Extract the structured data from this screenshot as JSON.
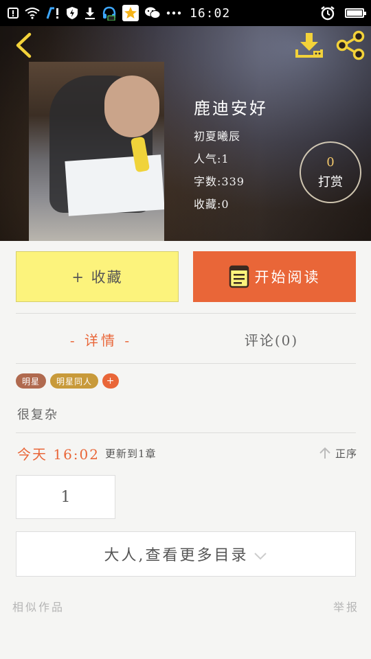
{
  "status_bar": {
    "time": "16:02",
    "icons": [
      "notification-icon",
      "wifi-icon",
      "app-icon",
      "shield-icon",
      "download-icon",
      "headset-icon",
      "star-icon",
      "wechat-icon",
      "more-icon",
      "alarm-icon",
      "battery-icon"
    ]
  },
  "book": {
    "title": "鹿迪安好",
    "author": "初夏曦辰",
    "popularity": "人气:1",
    "word_count": "字数:339",
    "favorites": "收藏:0"
  },
  "reward": {
    "count": "0",
    "label": "打赏"
  },
  "actions": {
    "collect_label": "+ 收藏",
    "read_label": "开始阅读"
  },
  "tabs": {
    "detail_label": "- 详情 -",
    "comments_label": "评论(0)"
  },
  "tags": [
    {
      "label": "明星"
    },
    {
      "label": "明星同人"
    },
    {
      "label": "+"
    }
  ],
  "description": "很复杂",
  "update": {
    "time": "今天 16:02",
    "text": "更新到1章",
    "sort_label": "正序"
  },
  "chapter_number": "1",
  "more_catalog_label": "大人,查看更多目录",
  "footer": {
    "similar_label": "相似作品",
    "report_label": "举报"
  },
  "colors": {
    "accent": "#e96638",
    "collect_bg": "#fcf37c",
    "page_bg": "#f5f5f3"
  }
}
